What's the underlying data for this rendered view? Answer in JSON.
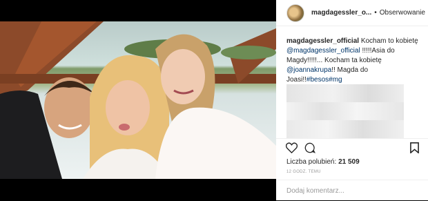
{
  "post": {
    "username": "magdagessler_o...",
    "follow_label": "Obserwowanie",
    "caption_user": "magdagessler_official",
    "caption_text_1": "Kocham to kobietę",
    "caption_mention_1": "@magdagessler_official",
    "caption_text_2": "!!!!!Asia do Magdy!!!!!... Kocham ta kobietę",
    "caption_mention_2": "@joannakrupa",
    "caption_text_3": "!! Magda do Joasi!!",
    "caption_tags": "#besos#mg",
    "likes_label": "Liczba polubień:",
    "likes_count": "21 509",
    "time_label": "12 GODZ. TEMU",
    "comment_placeholder": "Dodaj komentarz..."
  },
  "colors": {
    "mention": "#003569",
    "text": "#262626",
    "muted": "#999999"
  }
}
